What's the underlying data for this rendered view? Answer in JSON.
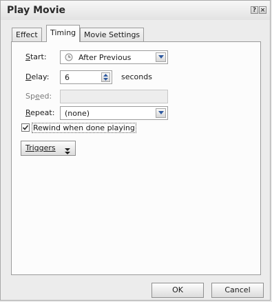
{
  "window": {
    "title": "Play Movie"
  },
  "tabs": [
    {
      "label": "Effect"
    },
    {
      "label": "Timing"
    },
    {
      "label": "Movie Settings"
    }
  ],
  "form": {
    "start": {
      "label": "Start:",
      "value": "After Previous",
      "icon": "clock-icon"
    },
    "delay": {
      "label": "Delay:",
      "value": "6",
      "unit": "seconds"
    },
    "speed": {
      "label": "Speed:",
      "value": ""
    },
    "repeat": {
      "label": "Repeat:",
      "value": "(none)"
    },
    "rewind": {
      "label": "Rewind when done playing",
      "checked": true
    },
    "triggers_label": "Triggers"
  },
  "buttons": {
    "ok": "OK",
    "cancel": "Cancel"
  },
  "title_bar": {
    "help": "?",
    "close": "×"
  }
}
